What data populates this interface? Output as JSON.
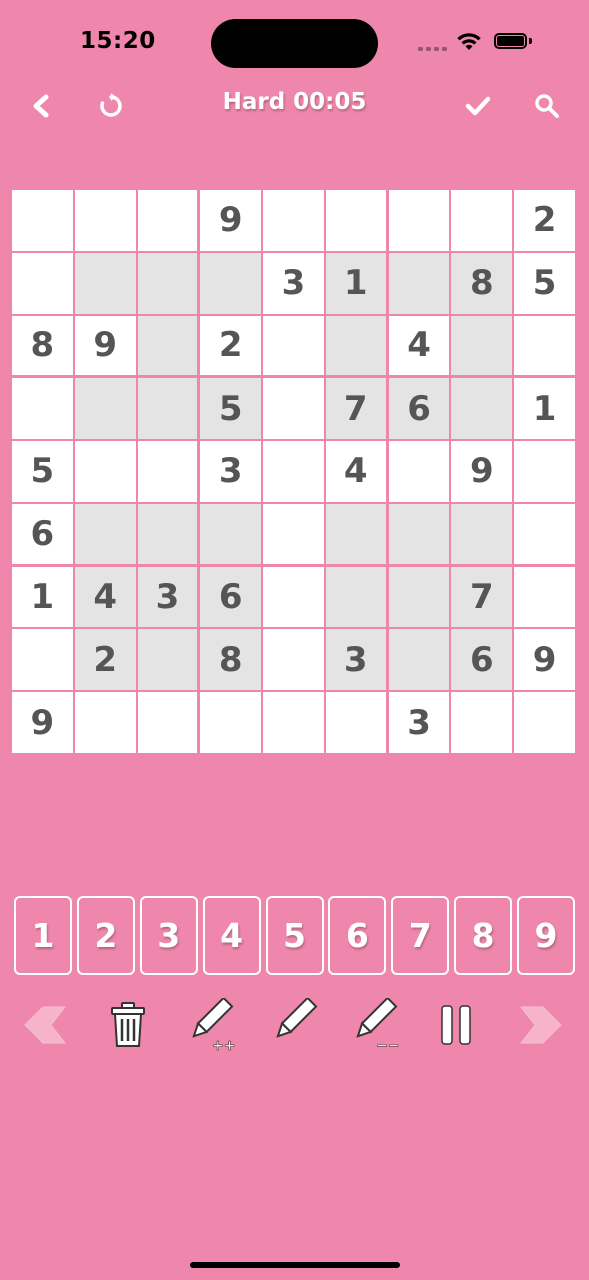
{
  "status_bar": {
    "time": "15:20"
  },
  "header": {
    "title": "Hard 00:05",
    "icons": [
      "back-icon",
      "restart-icon",
      "check-icon",
      "search-icon"
    ]
  },
  "board": {
    "rows": [
      [
        "",
        "",
        "",
        "9",
        "",
        "",
        "",
        "",
        "2"
      ],
      [
        "",
        "",
        "",
        "",
        "3",
        "1",
        "",
        "8",
        "5"
      ],
      [
        "8",
        "9",
        "",
        "2",
        "",
        "",
        "4",
        "",
        ""
      ],
      [
        "",
        "",
        "",
        "5",
        "",
        "7",
        "6",
        "",
        "1"
      ],
      [
        "5",
        "",
        "",
        "3",
        "",
        "4",
        "",
        "9",
        ""
      ],
      [
        "6",
        "",
        "",
        "",
        "",
        "",
        "",
        "",
        ""
      ],
      [
        "1",
        "4",
        "3",
        "6",
        "",
        "",
        "",
        "7",
        ""
      ],
      [
        "",
        "2",
        "",
        "8",
        "",
        "3",
        "",
        "6",
        "9"
      ],
      [
        "9",
        "",
        "",
        "",
        "",
        "",
        "3",
        "",
        ""
      ]
    ],
    "shaded": [
      [
        0,
        0,
        0,
        0,
        0,
        0,
        0,
        0,
        0
      ],
      [
        0,
        1,
        1,
        1,
        0,
        1,
        1,
        1,
        0
      ],
      [
        0,
        0,
        1,
        0,
        0,
        1,
        0,
        1,
        0
      ],
      [
        0,
        1,
        1,
        1,
        0,
        1,
        1,
        1,
        0
      ],
      [
        0,
        0,
        0,
        0,
        0,
        0,
        0,
        0,
        0
      ],
      [
        0,
        1,
        1,
        1,
        0,
        1,
        1,
        1,
        0
      ],
      [
        0,
        1,
        1,
        1,
        0,
        1,
        1,
        1,
        0
      ],
      [
        0,
        1,
        1,
        1,
        0,
        1,
        1,
        1,
        0
      ],
      [
        0,
        0,
        0,
        0,
        0,
        0,
        0,
        0,
        0
      ]
    ]
  },
  "numpad": [
    "1",
    "2",
    "3",
    "4",
    "5",
    "6",
    "7",
    "8",
    "9"
  ],
  "tools": [
    "undo-arrow-icon",
    "trash-icon",
    "pencil-add-notes-icon",
    "pencil-icon",
    "pencil-remove-notes-icon",
    "pause-icon",
    "redo-arrow-icon"
  ],
  "colors": {
    "background": "#ee87ab",
    "cell": "#ffffff",
    "cell_shaded": "#e4e4e4",
    "digit": "#555555",
    "grid_line": "#ee87ab"
  }
}
